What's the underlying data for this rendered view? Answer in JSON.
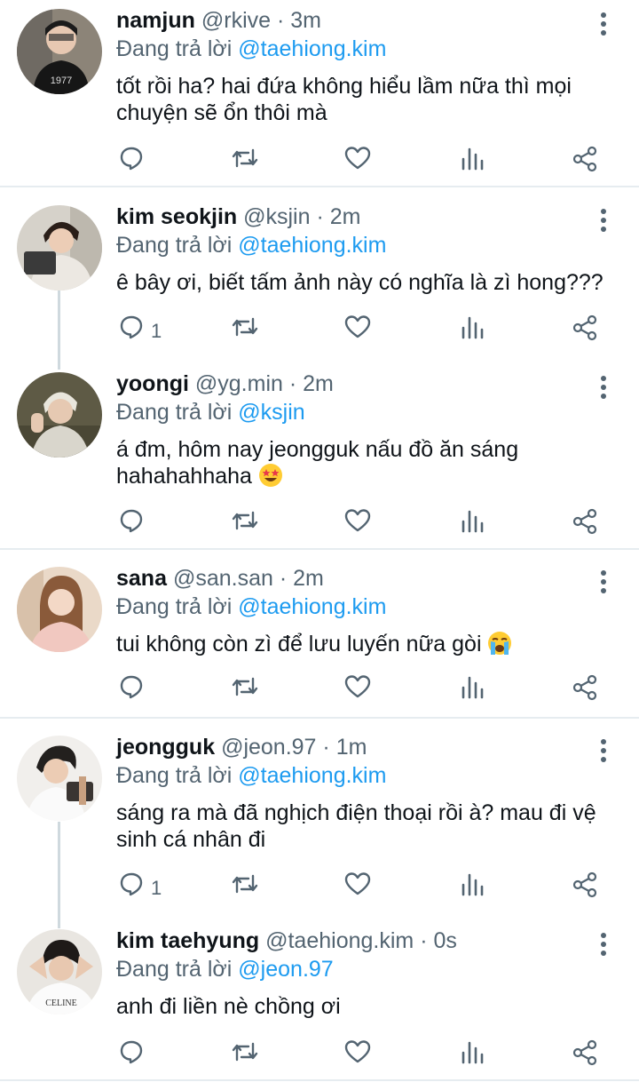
{
  "reply_prefix": "Đang trả lời",
  "tweets": [
    {
      "name": "namjun",
      "handle": "@rkive",
      "dot": "·",
      "time": "3m",
      "reply_to": "@taehiong.kim",
      "text": "tốt rồi ha? hai đứa không hiểu lầm nữa thì mọi chuyện sẽ ổn thôi mà",
      "reply_count": ""
    },
    {
      "name": "kim seokjin",
      "handle": "@ksjin",
      "dot": "·",
      "time": "2m",
      "reply_to": "@taehiong.kim",
      "text": "ê bây ơi, biết tấm ảnh này có nghĩa là zì hong???",
      "reply_count": "1"
    },
    {
      "name": "yoongi",
      "handle": "@yg.min",
      "dot": "·",
      "time": "2m",
      "reply_to": "@ksjin",
      "text": "á đm, hôm nay jeongguk nấu đồ ăn sáng hahahahhaha",
      "reply_count": "",
      "emoji": "star-struck-emoji"
    },
    {
      "name": "sana",
      "handle": "@san.san",
      "dot": "·",
      "time": "2m",
      "reply_to": "@taehiong.kim",
      "text": "tui không còn zì để lưu luyến nữa gòi",
      "reply_count": "",
      "emoji": "crying-emoji"
    },
    {
      "name": "jeongguk",
      "handle": "@jeon.97",
      "dot": "·",
      "time": "1m",
      "reply_to": "@taehiong.kim",
      "text": "sáng ra mà đã nghịch điện thoại rồi à? mau đi vệ sinh cá nhân đi",
      "reply_count": "1"
    },
    {
      "name": "kim taehyung",
      "handle": "@taehiong.kim",
      "dot": "·",
      "time": "0s",
      "reply_to": "@jeon.97",
      "text": "anh đi liền nè chồng ơi",
      "reply_count": ""
    }
  ],
  "avatar_text": {
    "shirt_1977": "1977",
    "shirt_celine": "CELINE"
  },
  "icons": [
    "reply-icon",
    "retweet-icon",
    "like-icon",
    "analytics-icon",
    "share-icon",
    "more-options-icon"
  ],
  "colors": {
    "mention": "#1d9bf0",
    "secondary": "#536471",
    "text": "#0f1419",
    "thread_line": "#cfd9de",
    "divider": "#e6ecf0"
  }
}
